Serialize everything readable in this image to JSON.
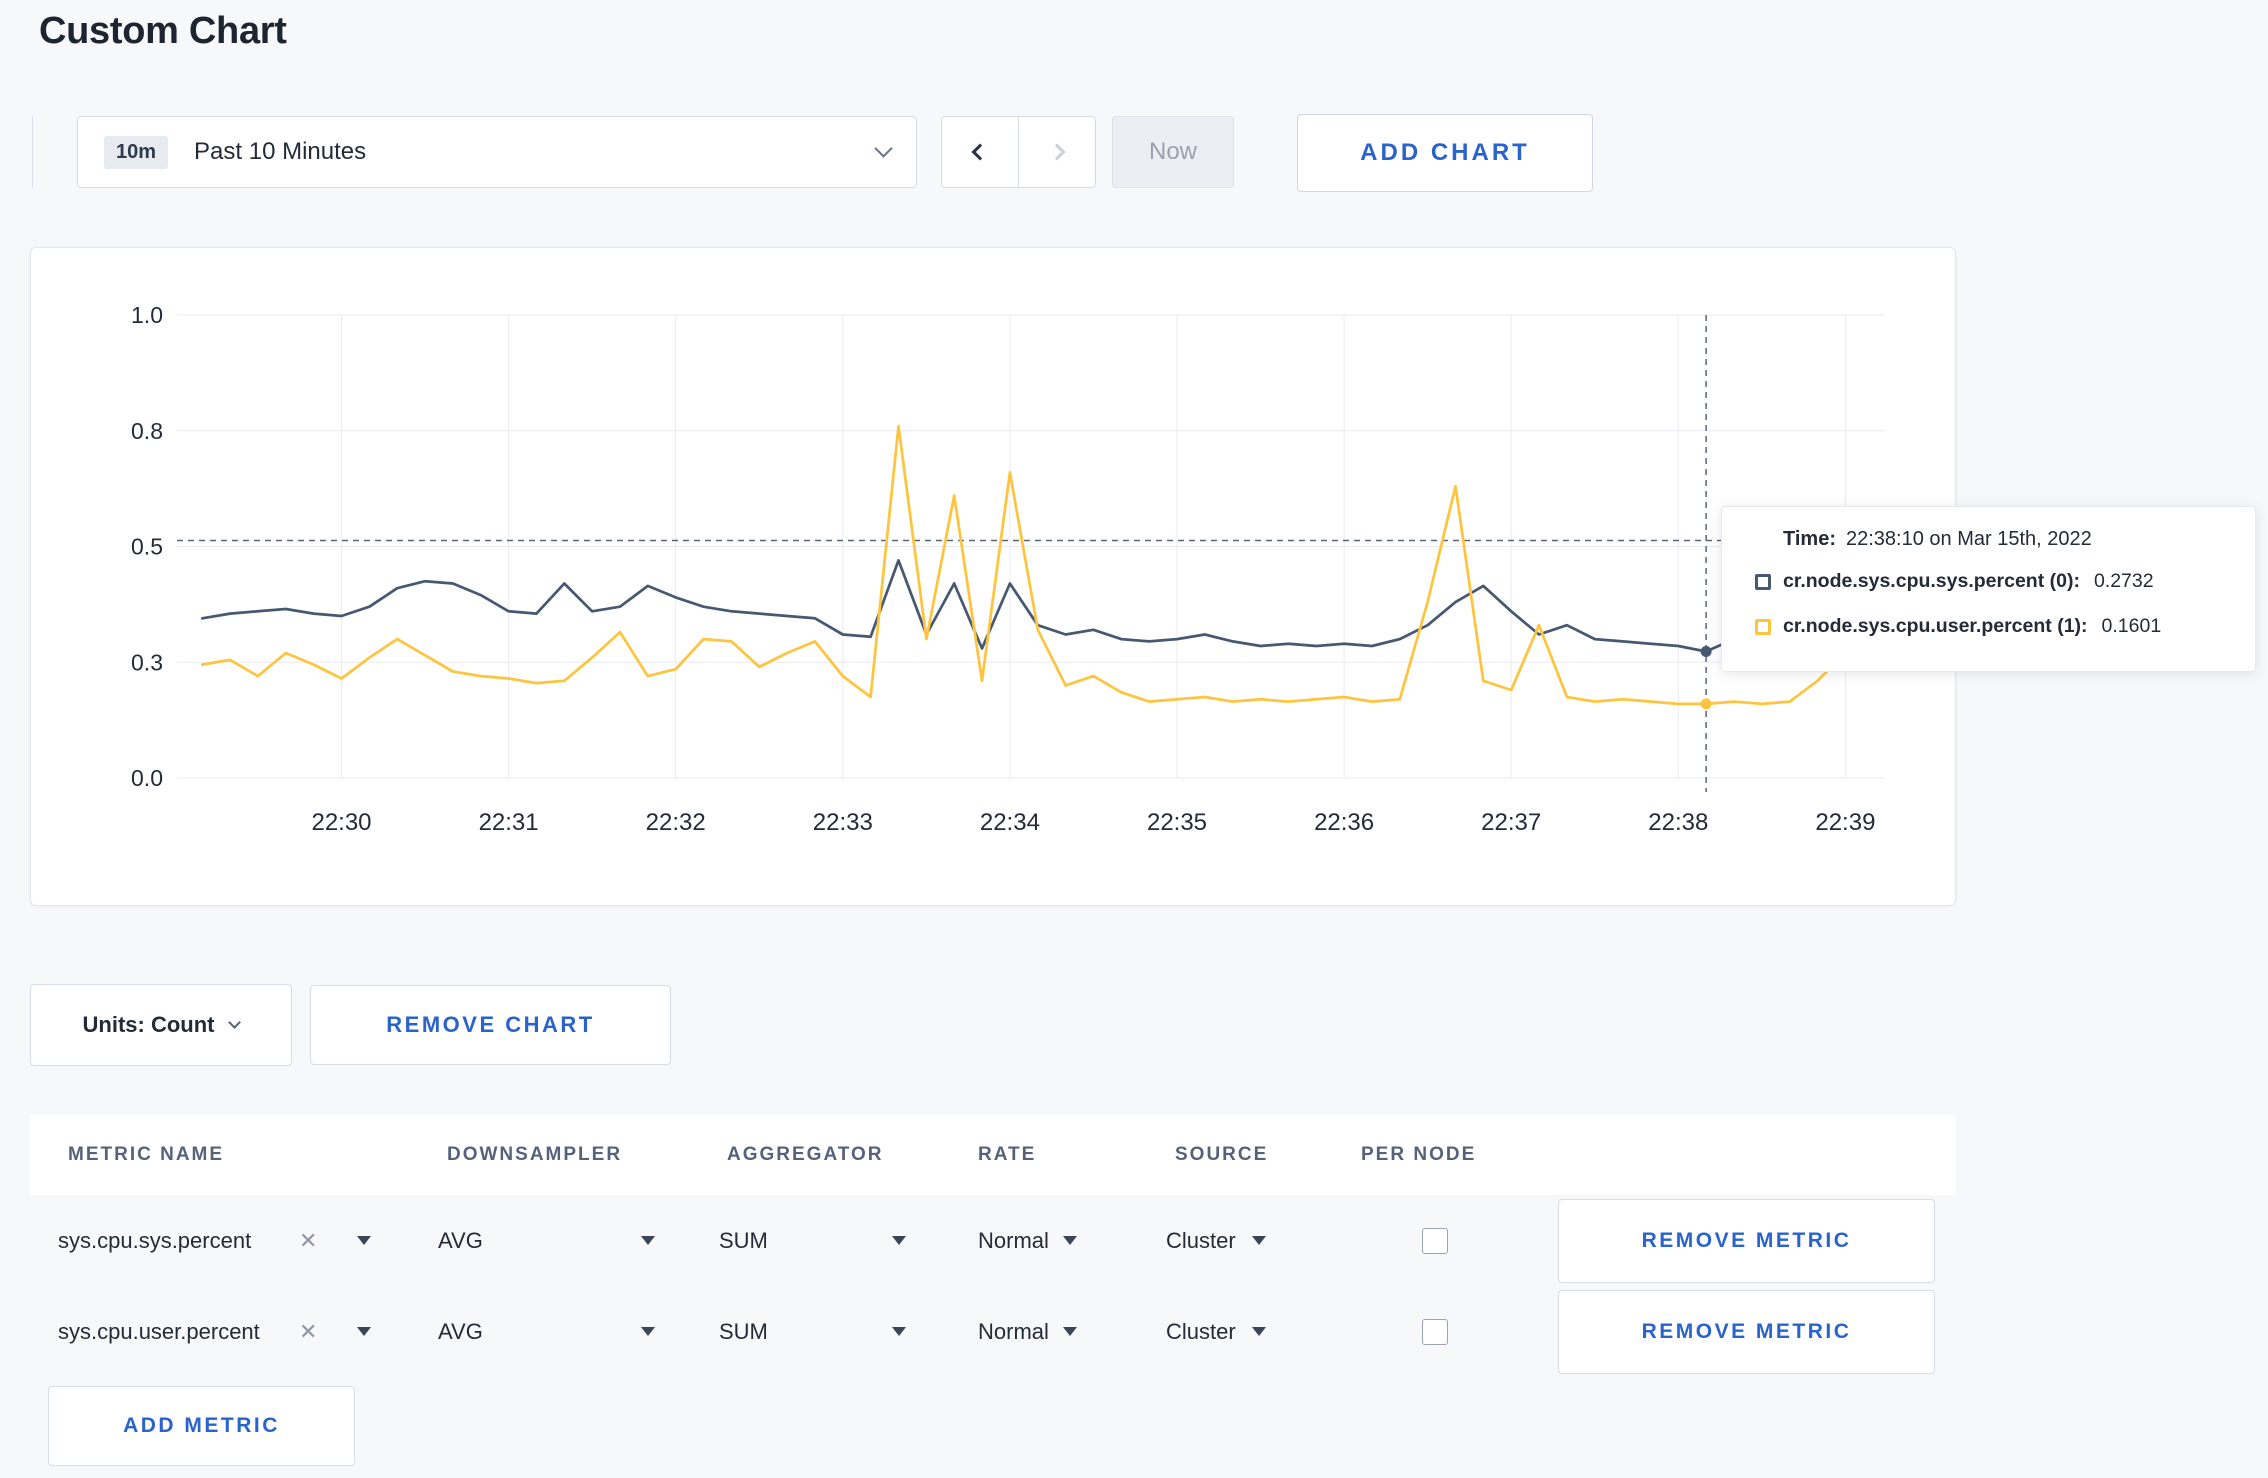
{
  "title": "Custom Chart",
  "toolbar": {
    "range_badge": "10m",
    "range_label": "Past 10 Minutes",
    "now_label": "Now",
    "add_chart_label": "ADD CHART"
  },
  "chart_actions": {
    "units_label": "Units: Count",
    "remove_chart_label": "REMOVE CHART"
  },
  "tooltip": {
    "time_label": "Time:",
    "time_value": "22:38:10 on Mar 15th, 2022",
    "rows": [
      {
        "name": "cr.node.sys.cpu.sys.percent (0):",
        "value": "0.2732",
        "color": "#475872"
      },
      {
        "name": "cr.node.sys.cpu.user.percent (1):",
        "value": "0.1601",
        "color": "#fdc53f"
      }
    ]
  },
  "metrics": {
    "headers": [
      "METRIC NAME",
      "DOWNSAMPLER",
      "AGGREGATOR",
      "RATE",
      "SOURCE",
      "PER NODE"
    ],
    "rows": [
      {
        "name": "sys.cpu.sys.percent",
        "clear": "✕",
        "downsampler": "AVG",
        "aggregator": "SUM",
        "rate": "Normal",
        "source": "Cluster",
        "per_node_checked": false,
        "remove_label": "REMOVE METRIC"
      },
      {
        "name": "sys.cpu.user.percent",
        "clear": "✕",
        "downsampler": "AVG",
        "aggregator": "SUM",
        "rate": "Normal",
        "source": "Cluster",
        "per_node_checked": false,
        "remove_label": "REMOVE METRIC"
      }
    ],
    "add_metric_label": "ADD METRIC"
  },
  "colors": {
    "accent_blue": "#2a63cc",
    "series_sys": "#475872",
    "series_user": "#fdc53f",
    "grid": "#e9ebf1",
    "axis_label": "#242b38",
    "crosshair": "#5a6477"
  },
  "chart_data": {
    "type": "line",
    "title": "",
    "xlabel": "",
    "ylabel": "",
    "ylim": [
      0,
      1.0
    ],
    "grid": true,
    "legend": "hidden",
    "y_ticks": [
      {
        "v": 0,
        "label": "0.0"
      },
      {
        "v": 0.25,
        "label": "0.3"
      },
      {
        "v": 0.5,
        "label": "0.5"
      },
      {
        "v": 0.75,
        "label": "0.8"
      },
      {
        "v": 1,
        "label": "1.0"
      }
    ],
    "x_ticks": [
      "22:30",
      "22:31",
      "22:32",
      "22:33",
      "22:34",
      "22:35",
      "22:36",
      "22:37",
      "22:38",
      "22:39"
    ],
    "sample_step_sec": 10,
    "first_sample_offset_sec": -50,
    "series": [
      {
        "name": "cr.node.sys.cpu.sys.percent",
        "color": "#475872",
        "values": [
          0.345,
          0.355,
          0.36,
          0.365,
          0.355,
          0.35,
          0.37,
          0.41,
          0.425,
          0.42,
          0.395,
          0.36,
          0.355,
          0.42,
          0.36,
          0.37,
          0.415,
          0.39,
          0.37,
          0.36,
          0.355,
          0.35,
          0.345,
          0.31,
          0.305,
          0.47,
          0.31,
          0.42,
          0.28,
          0.42,
          0.33,
          0.31,
          0.32,
          0.3,
          0.295,
          0.3,
          0.31,
          0.295,
          0.285,
          0.29,
          0.285,
          0.29,
          0.285,
          0.3,
          0.33,
          0.38,
          0.415,
          0.36,
          0.31,
          0.33,
          0.3,
          0.295,
          0.29,
          0.285,
          0.2732,
          0.3,
          0.32,
          0.3,
          0.295,
          0.31,
          0.3
        ]
      },
      {
        "name": "cr.node.sys.cpu.user.percent",
        "color": "#fdc53f",
        "values": [
          0.245,
          0.255,
          0.22,
          0.27,
          0.245,
          0.215,
          0.26,
          0.3,
          0.265,
          0.23,
          0.22,
          0.215,
          0.205,
          0.21,
          0.26,
          0.315,
          0.22,
          0.235,
          0.3,
          0.295,
          0.24,
          0.27,
          0.295,
          0.22,
          0.175,
          0.76,
          0.3,
          0.61,
          0.21,
          0.66,
          0.32,
          0.2,
          0.22,
          0.185,
          0.165,
          0.17,
          0.175,
          0.165,
          0.17,
          0.165,
          0.17,
          0.175,
          0.165,
          0.17,
          0.38,
          0.63,
          0.21,
          0.19,
          0.33,
          0.175,
          0.165,
          0.17,
          0.165,
          0.16,
          0.1601,
          0.165,
          0.16,
          0.165,
          0.21,
          0.27,
          0.24
        ]
      }
    ],
    "crosshair": {
      "time_offset_sec": 490,
      "hline_value": 0.513,
      "time_label": "22:38:10"
    }
  }
}
